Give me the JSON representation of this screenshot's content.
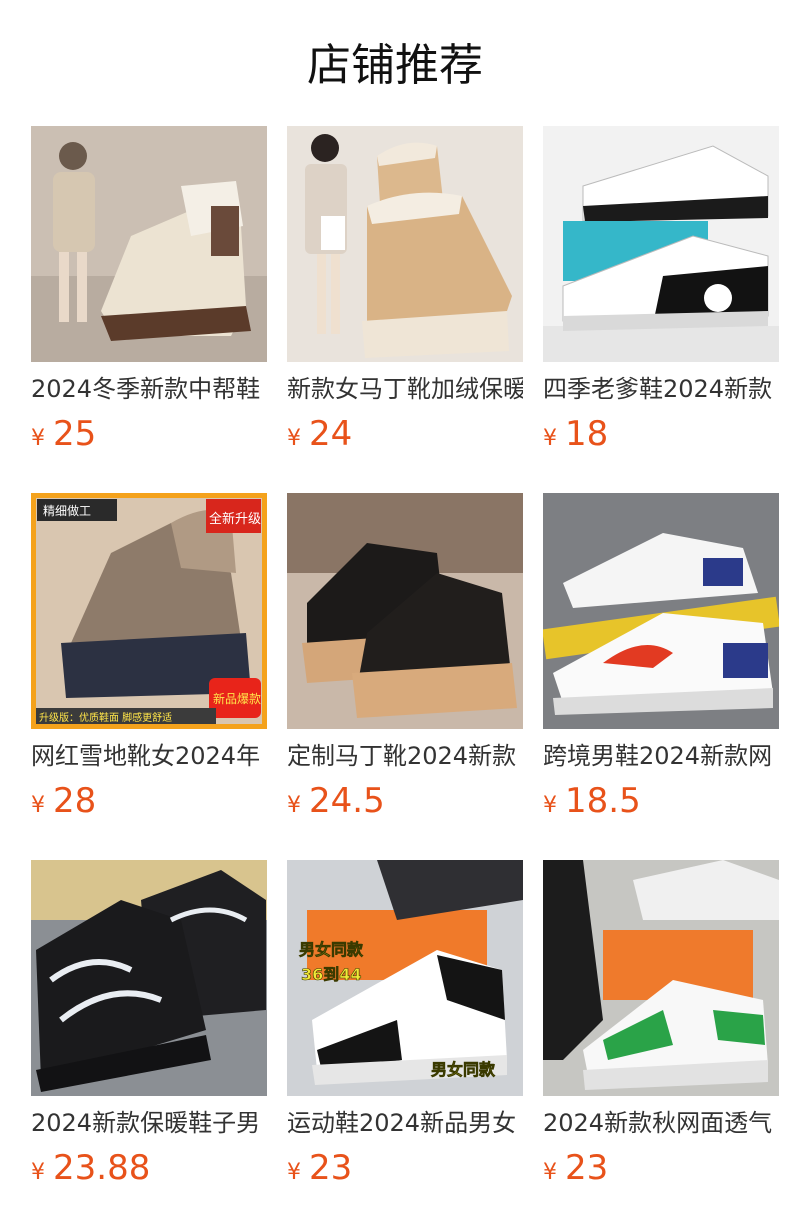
{
  "section_title": "店铺推荐",
  "colors": {
    "price": "#e8521a",
    "title": "#111111",
    "name": "#333333"
  },
  "products": [
    {
      "name": "2024冬季新款中帮鞋",
      "currency": "¥",
      "price": "25",
      "image": "beige-high-top-boot"
    },
    {
      "name": "新款女马丁靴加绒保暖",
      "currency": "¥",
      "price": "24",
      "image": "quilted-snow-boot"
    },
    {
      "name": "四季老爹鞋2024新款",
      "currency": "¥",
      "price": "18",
      "image": "white-black-dad-sneaker"
    },
    {
      "name": "网红雪地靴女2024年",
      "currency": "¥",
      "price": "28",
      "image": "grey-snow-boot-promo",
      "badges": [
        "精细做工",
        "全新升级",
        "新品爆款",
        "升级版：优质鞋面 脚感更舒适"
      ]
    },
    {
      "name": "定制马丁靴2024新款",
      "currency": "¥",
      "price": "24.5",
      "image": "black-martin-boot"
    },
    {
      "name": "跨境男鞋2024新款网",
      "currency": "¥",
      "price": "18.5",
      "image": "white-red-running-shoe"
    },
    {
      "name": "2024新款保暖鞋子男",
      "currency": "¥",
      "price": "23.88",
      "image": "black-knit-sneaker"
    },
    {
      "name": "运动鞋2024新品男女",
      "currency": "¥",
      "price": "23",
      "image": "black-white-air-sneaker",
      "badges": [
        "男女同款",
        "36到44",
        "男女同款"
      ]
    },
    {
      "name": "2024新款秋网面透气",
      "currency": "¥",
      "price": "23",
      "image": "white-green-mesh-sneaker"
    }
  ]
}
